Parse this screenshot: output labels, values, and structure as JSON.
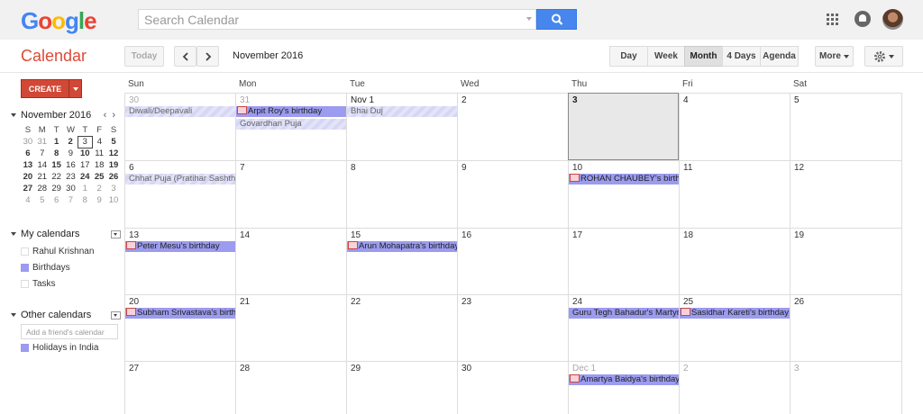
{
  "header": {
    "logo": "Google",
    "search_placeholder": "Search Calendar"
  },
  "app_title": "Calendar",
  "toolbar": {
    "today": "Today",
    "current_month": "November 2016",
    "views": [
      "Day",
      "Week",
      "Month",
      "4 Days",
      "Agenda"
    ],
    "selected_view": "Month",
    "more": "More"
  },
  "create_label": "CREATE",
  "mini_calendar": {
    "title": "November 2016",
    "dow": [
      "S",
      "M",
      "T",
      "W",
      "T",
      "F",
      "S"
    ],
    "weeks": [
      [
        "30",
        "31",
        "1",
        "2",
        "3",
        "4",
        "5"
      ],
      [
        "6",
        "7",
        "8",
        "9",
        "10",
        "11",
        "12"
      ],
      [
        "13",
        "14",
        "15",
        "16",
        "17",
        "18",
        "19"
      ],
      [
        "20",
        "21",
        "22",
        "23",
        "24",
        "25",
        "26"
      ],
      [
        "27",
        "28",
        "29",
        "30",
        "1",
        "2",
        "3"
      ],
      [
        "4",
        "5",
        "6",
        "7",
        "8",
        "9",
        "10"
      ]
    ]
  },
  "my_calendars": {
    "title": "My calendars",
    "items": [
      {
        "label": "Rahul Krishnan",
        "color": "#ffffff"
      },
      {
        "label": "Birthdays",
        "color": "#9b9bf0"
      },
      {
        "label": "Tasks",
        "color": "#ffffff"
      }
    ]
  },
  "other_calendars": {
    "title": "Other calendars",
    "add_placeholder": "Add a friend's calendar",
    "items": [
      {
        "label": "Holidays in India",
        "color": "#9b9bf0"
      }
    ]
  },
  "month_grid": {
    "days_of_week": [
      "Sun",
      "Mon",
      "Tue",
      "Wed",
      "Thu",
      "Fri",
      "Sat"
    ],
    "weeks": [
      [
        "30",
        "31",
        "Nov 1",
        "2",
        "3",
        "4",
        "5"
      ],
      [
        "6",
        "7",
        "8",
        "9",
        "10",
        "11",
        "12"
      ],
      [
        "13",
        "14",
        "15",
        "16",
        "17",
        "18",
        "19"
      ],
      [
        "20",
        "21",
        "22",
        "23",
        "24",
        "25",
        "26"
      ],
      [
        "27",
        "28",
        "29",
        "30",
        "Dec 1",
        "2",
        "3"
      ]
    ],
    "events": [
      {
        "week": 0,
        "day": 0,
        "slot": 0,
        "type": "holiday",
        "title": "Diwali/Deepavali",
        "span": 2
      },
      {
        "week": 0,
        "day": 1,
        "slot": 0,
        "type": "bday",
        "title": "Arpit Roy's birthday",
        "span": 1
      },
      {
        "week": 0,
        "day": 1,
        "slot": 1,
        "type": "holiday",
        "title": "Govardhan Puja",
        "span": 1
      },
      {
        "week": 0,
        "day": 2,
        "slot": 0,
        "type": "holiday",
        "title": "Bhai Duj",
        "span": 1
      },
      {
        "week": 1,
        "day": 0,
        "slot": 0,
        "type": "holiday",
        "title": "Chhat Puja (Pratihar Sashthi/Surya Sashthi)",
        "span": 1
      },
      {
        "week": 1,
        "day": 4,
        "slot": 0,
        "type": "bday",
        "title": "ROHAN CHAUBEY's birthday",
        "span": 1
      },
      {
        "week": 2,
        "day": 0,
        "slot": 0,
        "type": "bday",
        "title": "Peter Mesu's birthday",
        "span": 1
      },
      {
        "week": 2,
        "day": 2,
        "slot": 0,
        "type": "bday",
        "title": "Arun Mohapatra's birthday",
        "span": 1
      },
      {
        "week": 3,
        "day": 0,
        "slot": 0,
        "type": "bday",
        "title": "Subham Srivastava's birthday",
        "span": 1
      },
      {
        "week": 3,
        "day": 4,
        "slot": 0,
        "type": "holiday2",
        "title": "Guru Tegh Bahadur's Martyrdom Day",
        "span": 1
      },
      {
        "week": 3,
        "day": 5,
        "slot": 0,
        "type": "bday",
        "title": "Sasidhar Kareti's birthday",
        "span": 1
      },
      {
        "week": 4,
        "day": 4,
        "slot": 0,
        "type": "bday",
        "title": "Amartya Baidya's birthday",
        "span": 1
      }
    ]
  }
}
